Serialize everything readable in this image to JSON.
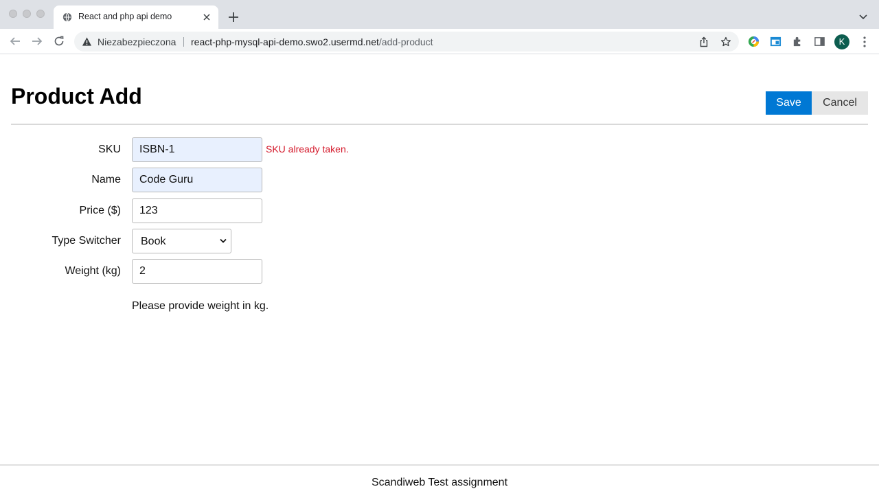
{
  "browser": {
    "tab_title": "React and php api demo",
    "security_label": "Niezabezpieczona",
    "url_host": "react-php-mysql-api-demo.swo2.usermd.net",
    "url_path": "/add-product",
    "profile_initial": "K"
  },
  "page": {
    "title": "Product Add",
    "save_label": "Save",
    "cancel_label": "Cancel"
  },
  "form": {
    "sku": {
      "label": "SKU",
      "value": "ISBN-1",
      "error": "SKU already taken."
    },
    "name": {
      "label": "Name",
      "value": "Code Guru"
    },
    "price": {
      "label": "Price ($)",
      "value": "123"
    },
    "type": {
      "label": "Type Switcher",
      "value": "Book"
    },
    "weight": {
      "label": "Weight (kg)",
      "value": "2",
      "hint": "Please provide weight in kg."
    }
  },
  "footer": {
    "text": "Scandiweb Test assignment"
  },
  "colors": {
    "accent": "#0078d4",
    "error": "#d4182a",
    "autofill": "#e8f0fe"
  }
}
